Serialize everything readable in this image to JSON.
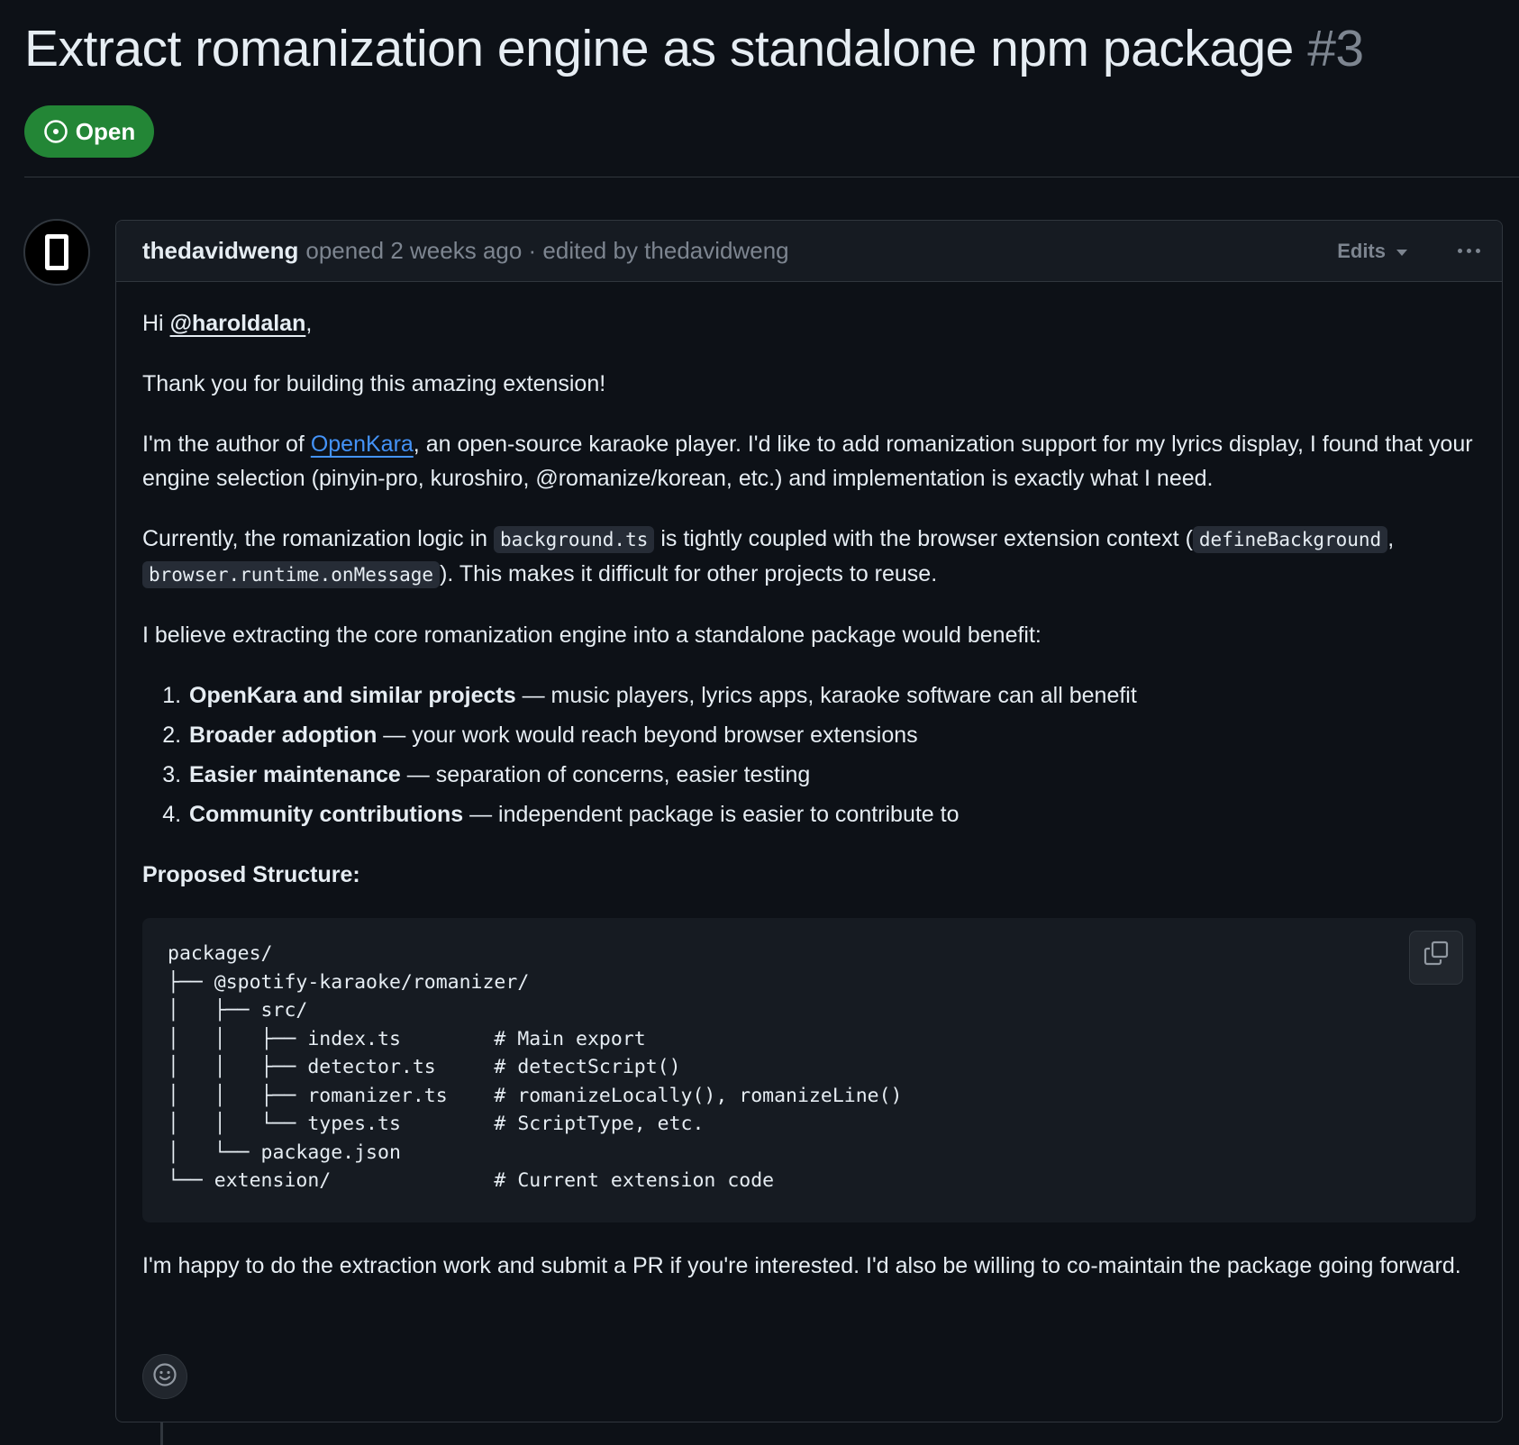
{
  "issue": {
    "title": "Extract romanization engine as standalone npm package",
    "number": "#3",
    "state": "Open"
  },
  "comment": {
    "author": "thedavidweng",
    "meta": "opened 2 weeks ago · edited by thedavidweng",
    "edits_label": "Edits",
    "greeting_prefix": "Hi ",
    "mention": "@haroldalan",
    "greeting_suffix": ",",
    "thanks": "Thank you for building this amazing extension!",
    "intro_prefix": "I'm the author of ",
    "intro_link": "OpenKara",
    "intro_suffix": ", an open-source karaoke player. I'd like to add romanization support for my lyrics display, I found that your engine selection (pinyin-pro, kuroshiro, @romanize/korean, etc.) and implementation is exactly what I need.",
    "current_1": "Currently, the romanization logic in ",
    "code_background": "background.ts",
    "current_2": " is tightly coupled with the browser extension context (",
    "code_define": "defineBackground",
    "current_3": ", ",
    "code_runtime": "browser.runtime.onMessage",
    "current_4": "). This makes it difficult for other projects to reuse.",
    "believe": "I believe extracting the core romanization engine into a standalone package would benefit:",
    "benefits": [
      {
        "strong": "OpenKara and similar projects",
        "rest": " — music players, lyrics apps, karaoke software can all benefit"
      },
      {
        "strong": "Broader adoption",
        "rest": " — your work would reach beyond browser extensions"
      },
      {
        "strong": "Easier maintenance",
        "rest": " — separation of concerns, easier testing"
      },
      {
        "strong": "Community contributions",
        "rest": " — independent package is easier to contribute to"
      }
    ],
    "proposed_heading": "Proposed Structure:",
    "code_lines": [
      "packages/",
      "├── @spotify-karaoke/romanizer/",
      "│   ├── src/",
      "│   │   ├── index.ts        # Main export",
      "│   │   ├── detector.ts     # detectScript()",
      "│   │   ├── romanizer.ts    # romanizeLocally(), romanizeLine()",
      "│   │   └── types.ts        # ScriptType, etc.",
      "│   └── package.json",
      "└── extension/              # Current extension code"
    ],
    "closing": "I'm happy to do the extraction work and submit a PR if you're interested. I'd also be willing to co-maintain the package going forward."
  },
  "icons": {
    "state": "issue-opened-icon",
    "copy": "copy-icon",
    "reaction": "smiley-icon",
    "menu": "kebab-horizontal-icon",
    "caret": "triangle-down-icon"
  },
  "colors": {
    "background": "#0d1117",
    "open_badge": "#238636",
    "link": "#4493f8",
    "muted": "#7d8590",
    "border": "#30363d"
  }
}
